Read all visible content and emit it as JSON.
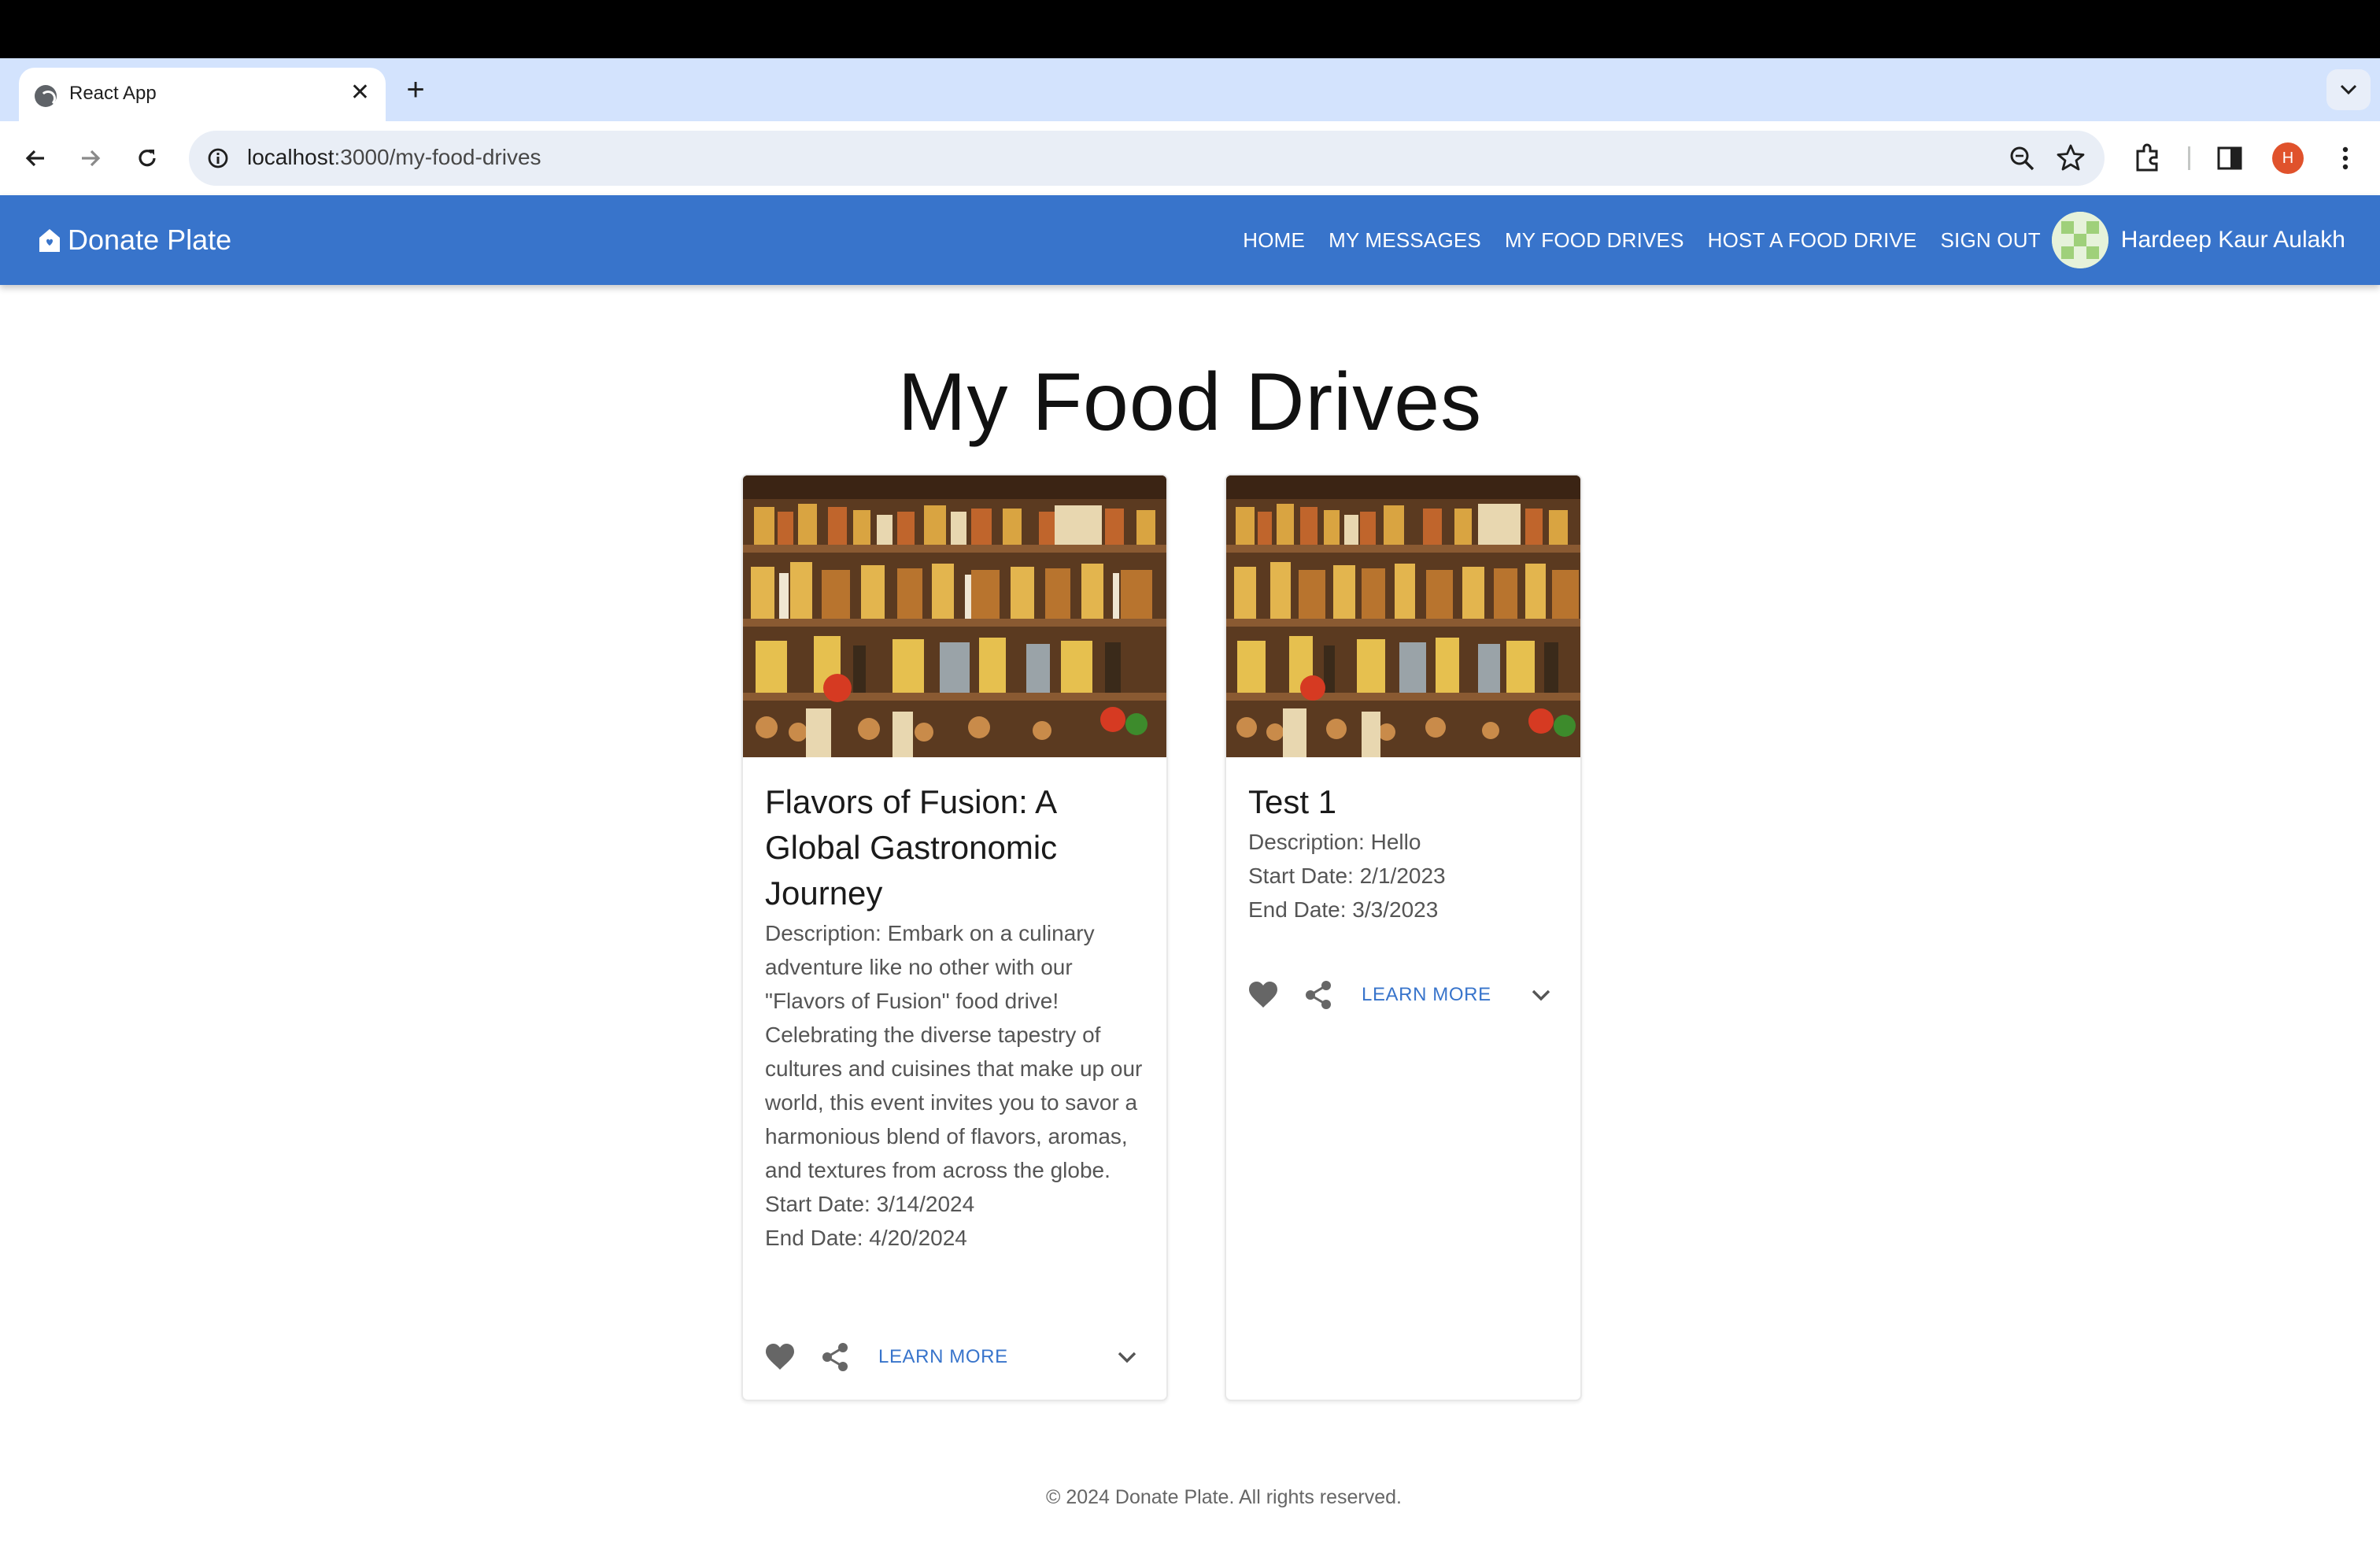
{
  "browser": {
    "tab_title": "React App",
    "tab_close": "✕",
    "new_tab": "+",
    "url_host": "localhost",
    "url_rest": ":3000/my-food-drives",
    "profile_initial": "H"
  },
  "app": {
    "brand": "Donate Plate",
    "nav": [
      "HOME",
      "MY MESSAGES",
      "MY FOOD DRIVES",
      "HOST A FOOD DRIVE",
      "SIGN OUT"
    ],
    "user_name": "Hardeep Kaur Aulakh",
    "accent": "#3874cb"
  },
  "page": {
    "title": "My Food Drives"
  },
  "cards": [
    {
      "title": "Flavors of Fusion: A Global Gastronomic Journey",
      "description": "Description: Embark on a culinary adventure like no other with our \"Flavors of Fusion\" food drive! Celebrating the diverse tapestry of cultures and cuisines that make up our world, this event invites you to savor a harmonious blend of flavors, aromas, and textures from across the globe.",
      "start": "Start Date: 3/14/2024",
      "end": "End Date: 4/20/2024",
      "learn_more": "LEARN MORE"
    },
    {
      "title": "Test 1",
      "description": "Description: Hello",
      "start": "Start Date: 2/1/2023",
      "end": "End Date: 3/3/2023",
      "learn_more": "LEARN MORE"
    }
  ],
  "footer": "© 2024 Donate Plate. All rights reserved."
}
